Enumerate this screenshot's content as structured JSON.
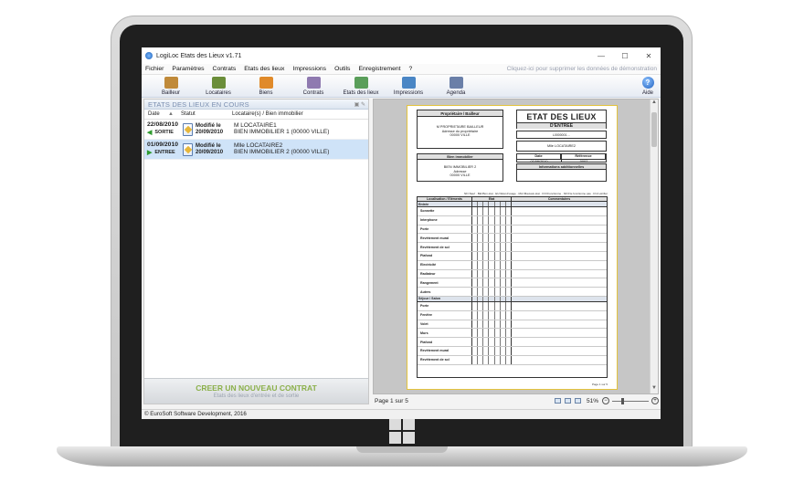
{
  "window": {
    "title": "LogiLoc Etats des Lieux v1.71",
    "minimize": "—",
    "maximize": "☐",
    "close": "✕"
  },
  "menu": {
    "items": [
      "Fichier",
      "Paramètres",
      "Contrats",
      "Etats des lieux",
      "Impressions",
      "Outils",
      "Enregistrement",
      "?"
    ],
    "demo_link": "Cliquez-ici pour supprimer les données de démonstration"
  },
  "toolbar": {
    "items": [
      {
        "label": "Bailleur",
        "icon": "landlord-icon",
        "color": "#c08a3a"
      },
      {
        "label": "Locataires",
        "icon": "tenants-icon",
        "color": "#6b8e3a"
      },
      {
        "label": "Biens",
        "icon": "house-icon",
        "color": "#e08a2a"
      },
      {
        "label": "Contrats",
        "icon": "contract-pen-icon",
        "color": "#8f7ab0"
      },
      {
        "label": "Etats des lieux",
        "icon": "inventory-checklist-icon",
        "color": "#5a9e5a"
      },
      {
        "label": "Impressions",
        "icon": "printer-icon",
        "color": "#4a86c5"
      },
      {
        "label": "Agenda",
        "icon": "calendar-icon",
        "color": "#6a7fa8"
      }
    ],
    "help_label": "Aide",
    "help_glyph": "?"
  },
  "left_panel": {
    "title": "ETATS DES LIEUX EN COURS",
    "header_icons": "▣ ✎",
    "columns": [
      "Date",
      "▲",
      "Statut",
      "Locataire(s) / Bien immobilier"
    ],
    "rows": [
      {
        "date": "22/08/2010",
        "type": "SORTIE",
        "arrow": "◀",
        "status": "Modifié le",
        "status_date": "20/09/2010",
        "tenant": "M LOCATAIRE1",
        "property": "BIEN IMMOBILIER 1 (00000 VILLE)",
        "selected": false
      },
      {
        "date": "01/09/2010",
        "type": "ENTREE",
        "arrow": "▶",
        "status": "Modifié le",
        "status_date": "20/09/2010",
        "tenant": "Mlle LOCATAIRE2",
        "property": "BIEN IMMOBILIER 2 (00000 VILLE)",
        "selected": true
      }
    ],
    "new_contract_title": "CREER UN NOUVEAU CONTRAT",
    "new_contract_sub": "Etats des lieux d'entrée et de sortie"
  },
  "preview": {
    "owner_header": "Propriétaire / Bailleur",
    "owner_lines": [
      "M PROPRIETAIRE BAILLEUR",
      "Adresse du propriétaire",
      "00000 VILLE"
    ],
    "doc_title": "ETAT DES LIEUX",
    "doc_subtitle": "D'ENTREE",
    "reference": "L0000001…",
    "tenant": "Mlle LOCATAIRE2",
    "property_header": "Bien immobilier",
    "property_lines": [
      "BIEN IMMOBILIER 2",
      "Adresse",
      "00000 VILLE"
    ],
    "date_header": "Date",
    "date_value": "01/09/2010",
    "ref_header": "Référence",
    "ref_value": "0002",
    "info_header": "Informations additionnelles",
    "legend": "NF=Neuf · BE=Bon état · EU=Etat d'usage · MA=Mauvais état · FO=Fonctionne · NF=Ne fonctionne pas · D=A vérifier",
    "col_location": "Localisation / Eléments",
    "col_state": "Etat",
    "col_comments": "Commentaires",
    "rows": [
      {
        "name": "Entrée",
        "section": true
      },
      {
        "name": "Sonnette"
      },
      {
        "name": "Interphone"
      },
      {
        "name": "Porte"
      },
      {
        "name": "Revêtement mural"
      },
      {
        "name": "Revêtement de sol"
      },
      {
        "name": "Plafond"
      },
      {
        "name": "Electricité"
      },
      {
        "name": "Radiateur"
      },
      {
        "name": "Rangement"
      },
      {
        "name": "Autres"
      },
      {
        "name": "Séjour / Salon",
        "section": true
      },
      {
        "name": "Porte"
      },
      {
        "name": "Fenêtre"
      },
      {
        "name": "Volet"
      },
      {
        "name": "Murs"
      },
      {
        "name": "Plafond"
      },
      {
        "name": "Revêtement mural"
      },
      {
        "name": "Revêtement de sol"
      }
    ],
    "page_footer": "Page 1 sur 5"
  },
  "status": {
    "page": "Page 1 sur 5",
    "zoom": "51%",
    "zoom_fraction": 0.28
  },
  "footer": {
    "copyright": "© EuroSoft Software Development, 2016"
  }
}
